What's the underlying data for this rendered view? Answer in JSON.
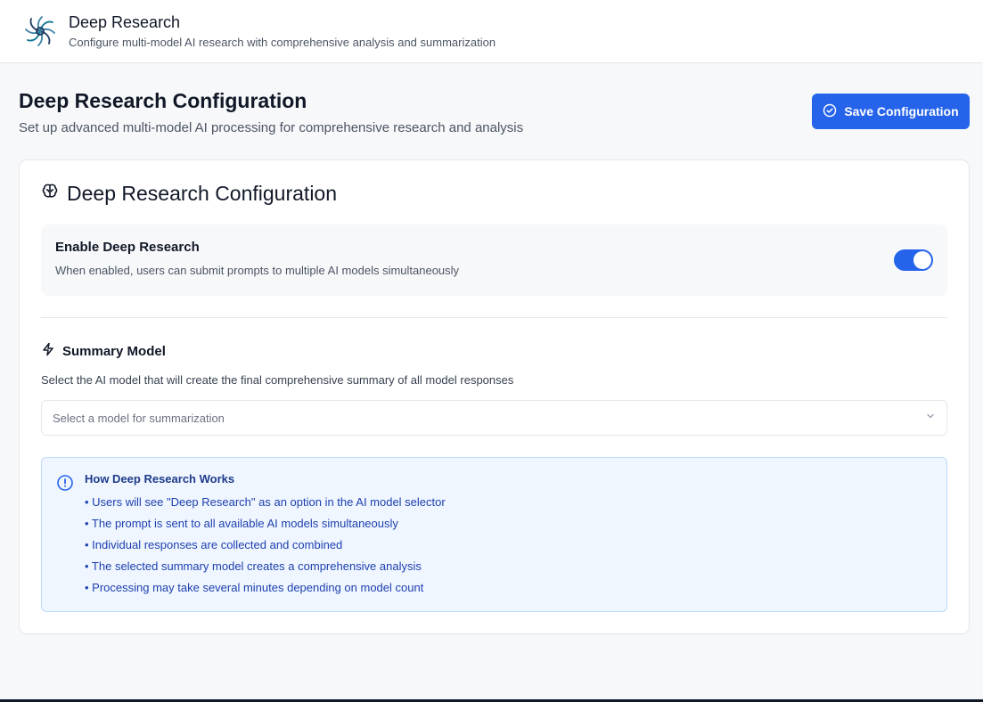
{
  "header": {
    "title": "Deep Research",
    "subtitle": "Configure multi-model AI research with comprehensive analysis and summarization"
  },
  "page": {
    "title": "Deep Research Configuration",
    "subtitle": "Set up advanced multi-model AI processing for comprehensive research and analysis",
    "save_label": "Save Configuration"
  },
  "card": {
    "title": "Deep Research Configuration",
    "enable": {
      "label": "Enable Deep Research",
      "description": "When enabled, users can submit prompts to multiple AI models simultaneously",
      "enabled": true
    },
    "summary": {
      "title": "Summary Model",
      "description": "Select the AI model that will create the final comprehensive summary of all model responses",
      "placeholder": "Select a model for summarization"
    },
    "info": {
      "title": "How Deep Research Works",
      "items": [
        "• Users will see \"Deep Research\" as an option in the AI model selector",
        "• The prompt is sent to all available AI models simultaneously",
        "• Individual responses are collected and combined",
        "• The selected summary model creates a comprehensive analysis",
        "• Processing may take several minutes depending on model count"
      ]
    }
  },
  "colors": {
    "accent": "#2563eb",
    "info_bg": "#eff6ff",
    "info_text": "#1e40af"
  },
  "icons": {
    "logo": "spiral-logo-icon",
    "save": "check-circle-icon",
    "card_title": "brain-icon",
    "summary": "zap-icon",
    "select": "chevron-down-icon",
    "info": "alert-circle-icon"
  }
}
